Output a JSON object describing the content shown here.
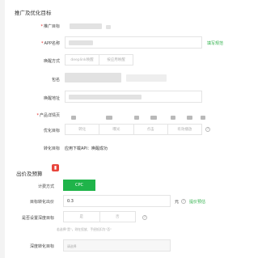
{
  "section1": {
    "title": "推广及优化目标"
  },
  "fields": {
    "promo_target": "推广目标",
    "app_name": "APP名称",
    "wake_method": "唤醒方式",
    "package": "包名",
    "wake_url": "唤醒地址",
    "product_detail": "产品详情页",
    "opt_target": "优化目标",
    "convert_target": "转化目标"
  },
  "app_name_link": "填写规范",
  "wake_options": [
    "deeplink唤醒",
    "按应用唤醒"
  ],
  "opt_options": [
    "转化",
    "曝光",
    "点击",
    "有效播放"
  ],
  "convert_value": "应用下载API：唤醒成功",
  "section2": {
    "title": "出价及预算"
  },
  "bid": {
    "mode_label": "计费方式",
    "mode_value": "CPC",
    "target_price_label": "目标转化出价",
    "target_price_value": "0.3",
    "unit": "元",
    "price_link": "提价预估",
    "deep_label": "是否设置深度目标",
    "deep_options": [
      "是",
      "否"
    ],
    "deep_hint": "若选择\"是\"，则在投放、手经抵扣为\"否\"",
    "deep_convert_label": "深度转化目标",
    "deep_convert_placeholder": "请选择"
  },
  "colors": {
    "accent": "#1fb44a",
    "badge": "#e8453c",
    "required": "#e02020"
  }
}
